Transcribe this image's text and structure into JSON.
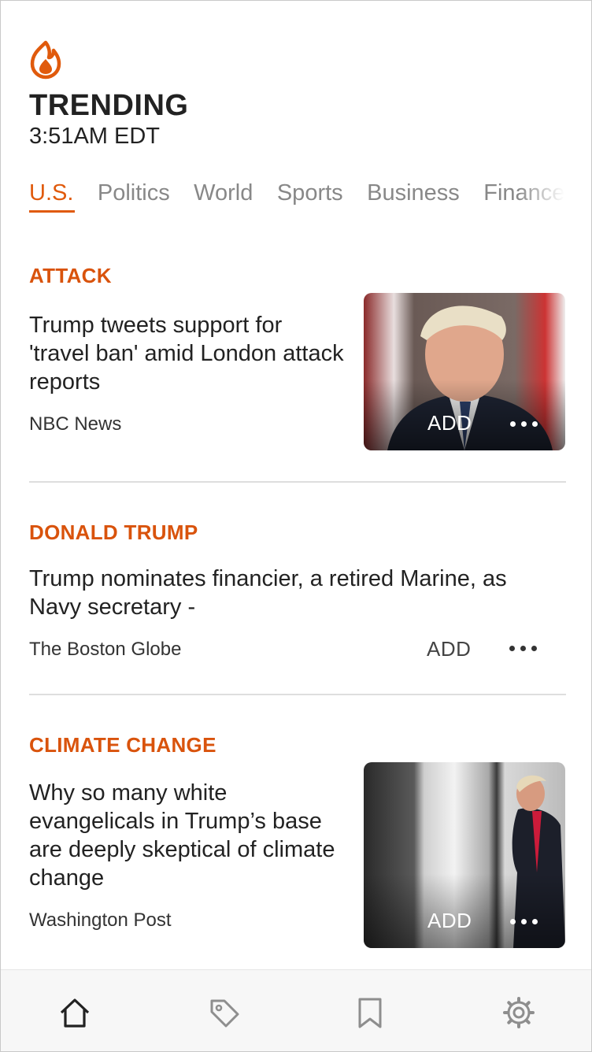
{
  "header": {
    "title": "TRENDING",
    "time": "3:51AM EDT",
    "logo_icon": "flame-icon",
    "accent_color": "#e05a0c"
  },
  "tabs": [
    {
      "label": "U.S.",
      "active": true
    },
    {
      "label": "Politics",
      "active": false
    },
    {
      "label": "World",
      "active": false
    },
    {
      "label": "Sports",
      "active": false
    },
    {
      "label": "Business",
      "active": false
    },
    {
      "label": "Finance",
      "active": false
    }
  ],
  "stories": [
    {
      "topic": "ATTACK",
      "headline": "Trump tweets support for 'travel ban' amid London attack reports",
      "source": "NBC News",
      "add_label": "ADD",
      "has_image": true
    },
    {
      "topic": "DONALD TRUMP",
      "headline": "Trump nominates financier, a retired Marine, as Navy secretary -",
      "source": "The Boston Globe",
      "add_label": "ADD",
      "has_image": false
    },
    {
      "topic": "CLIMATE CHANGE",
      "headline": "Why so many white evangelicals in Trump’s base are deeply skeptical of climate change",
      "source": "Washington Post",
      "add_label": "ADD",
      "has_image": true
    }
  ],
  "tabbar": {
    "items": [
      "home-icon",
      "tag-icon",
      "bookmark-icon",
      "settings-icon"
    ]
  }
}
